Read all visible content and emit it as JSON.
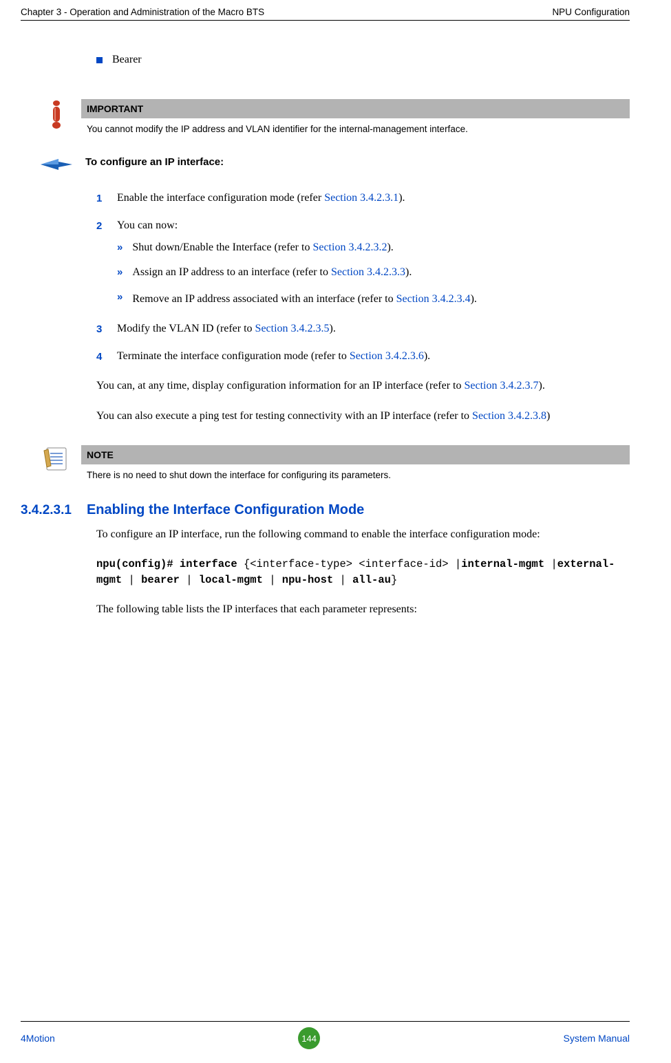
{
  "header": {
    "left": "Chapter 3 - Operation and Administration of the Macro BTS",
    "right": "NPU Configuration"
  },
  "bullet": "Bearer",
  "callout_important": {
    "title": "IMPORTANT",
    "text": "You cannot modify the IP address and VLAN identifier for the internal-management interface."
  },
  "proc_title": "To configure an IP interface:",
  "steps": {
    "s1": {
      "num": "1",
      "p1": "Enable the interface configuration mode (refer ",
      "l1": "Section 3.4.2.3.1",
      "p2": ")."
    },
    "s2": {
      "num": "2",
      "p1": "You can now:"
    },
    "sub_a": {
      "p1": "Shut down/Enable the Interface (refer to ",
      "l1": "Section 3.4.2.3.2",
      "p2": ")."
    },
    "sub_b": {
      "p1": "Assign an IP address to an interface (refer to ",
      "l1": "Section 3.4.2.3.3",
      "p2": ")."
    },
    "sub_c": {
      "p1": "Remove an IP address associated with an interface (refer to ",
      "l1": "Section 3.4.2.3.4",
      "p2": ")."
    },
    "s3": {
      "num": "3",
      "p1": "Modify the VLAN ID (refer to ",
      "l1": "Section 3.4.2.3.5",
      "p2": ")."
    },
    "s4": {
      "num": "4",
      "p1": "Terminate the interface configuration mode (refer to ",
      "l1": "Section 3.4.2.3.6",
      "p2": ")."
    }
  },
  "para1": {
    "p1": "You can, at any time, display configuration information for an IP interface (refer to ",
    "l1": "Section 3.4.2.3.7",
    "p2": ")."
  },
  "para2": {
    "p1": "You can also execute a ping test for testing connectivity with an IP interface (refer to ",
    "l1": "Section 3.4.2.3.8",
    "p2": ")"
  },
  "callout_note": {
    "title": "NOTE",
    "text": "There is no need to shut down the interface for configuring its parameters."
  },
  "section": {
    "num": "3.4.2.3.1",
    "title": "Enabling the Interface Configuration Mode"
  },
  "sec_para": "To configure an IP interface, run the following command to enable the interface configuration mode:",
  "code": {
    "c1": "npu(config)# interface ",
    "c2": "{<interface-type> <interface-id> |",
    "c3": "internal-mgmt ",
    "c4": "|",
    "c5": "external-mgmt ",
    "c6": "| ",
    "c7": "bearer ",
    "c8": "| ",
    "c9": "local-mgmt ",
    "c10": "| ",
    "c11": "npu-host ",
    "c12": "| ",
    "c13": "all-au",
    "c14": "}"
  },
  "sec_para2": "The following table lists the IP interfaces that each parameter represents:",
  "footer": {
    "left": "4Motion",
    "page": "144",
    "right": "System Manual"
  },
  "glyphs": {
    "chev": "»"
  }
}
